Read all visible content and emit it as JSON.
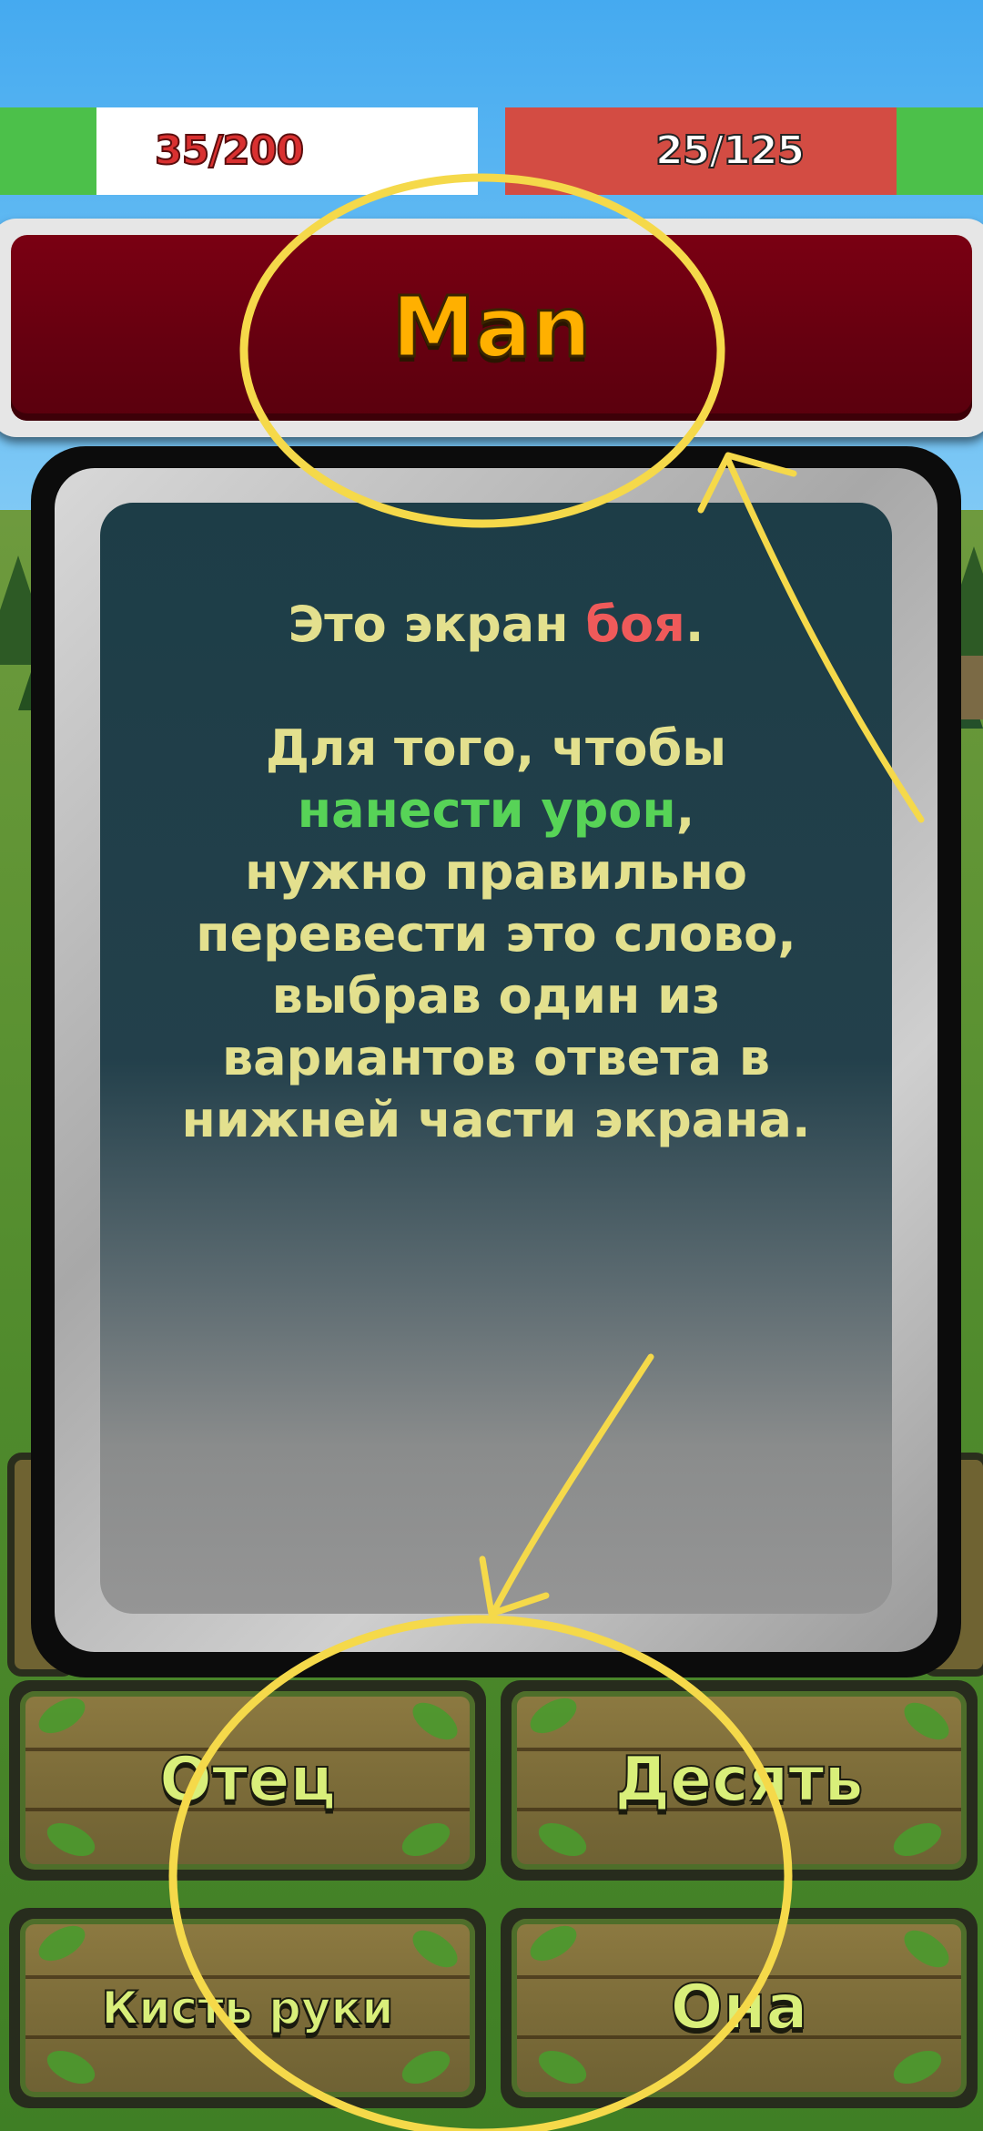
{
  "hud": {
    "player_hp": "35/200",
    "player_hp_fraction": 0.175,
    "enemy_hp": "25/125",
    "enemy_hp_fraction": 0.2
  },
  "word": {
    "text": "Man"
  },
  "dialog": {
    "line1_prefix": "Это экран ",
    "line1_highlight": "боя",
    "line1_suffix": ".",
    "para_a": "Для того, чтобы",
    "para_highlight": "нанести урон",
    "para_comma": ",",
    "para_rest": "нужно правильно перевести это слово, выбрав один из вариантов ответа в нижней части экрана."
  },
  "answers": [
    {
      "label": "Отец"
    },
    {
      "label": "Десять"
    },
    {
      "label": "Кисть руки"
    },
    {
      "label": "Она"
    }
  ],
  "colors": {
    "hp_green": "#4cc04a",
    "enemy_red": "#d34c43",
    "word_gold": "#ffb000",
    "annotation_yellow": "#f5d94a"
  }
}
